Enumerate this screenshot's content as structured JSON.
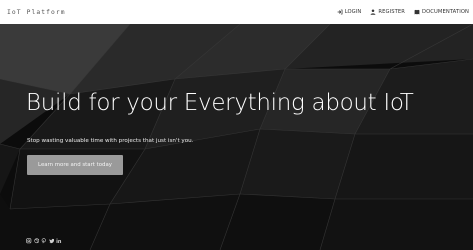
{
  "navbar": {
    "brand": "IoT Platform",
    "links": [
      {
        "label": "LOGIN",
        "icon": "login-icon"
      },
      {
        "label": "REGISTER",
        "icon": "user-icon"
      },
      {
        "label": "DOCUMENTATION",
        "icon": "book-icon"
      }
    ]
  },
  "hero": {
    "headline": "Build for your Everything about IoT",
    "subline": "Stop wasting valuable time with projects that just isn't you.",
    "cta_label": "Learn more and start today"
  },
  "social_icons": [
    "instagram-icon",
    "dribbble-icon",
    "pinterest-icon",
    "twitter-icon",
    "linkedin-icon"
  ],
  "colors": {
    "hero_background": "#0d0d0d",
    "cta_background": "#9a9a9a",
    "navbar_background": "#ffffff"
  }
}
